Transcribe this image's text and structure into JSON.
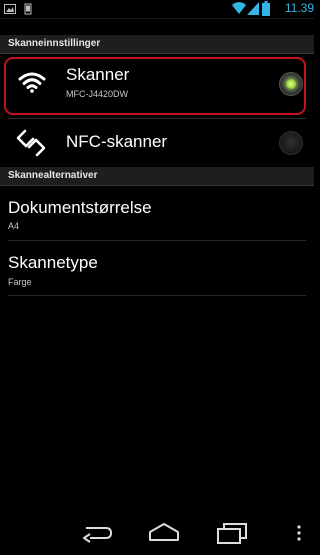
{
  "statusbar": {
    "time": "11.39"
  },
  "section_settings": {
    "title": "Skanneinnstillinger"
  },
  "scanner_item": {
    "title": "Skanner",
    "subtitle": "MFC-J4420DW",
    "selected": true
  },
  "nfc_item": {
    "title": "NFC-skanner",
    "selected": false
  },
  "section_options": {
    "title": "Skannealternativer"
  },
  "doc_size_item": {
    "title": "Dokumentstørrelse",
    "value": "A4"
  },
  "scan_type_item": {
    "title": "Skannetype",
    "value": "Farge"
  },
  "icons": {
    "status_left": [
      "image-notification-icon",
      "phone-notification-icon"
    ],
    "status_right": [
      "wifi-signal-icon",
      "cell-signal-icon",
      "battery-icon"
    ],
    "scanner": "wifi-icon",
    "nfc": "nfc-icon",
    "nav": [
      "back-icon",
      "home-icon",
      "recent-apps-icon",
      "menu-icon"
    ]
  },
  "colors": {
    "accent": "#33b5e5",
    "highlight": "#c0151c",
    "radio_on": "#9bd23a"
  }
}
